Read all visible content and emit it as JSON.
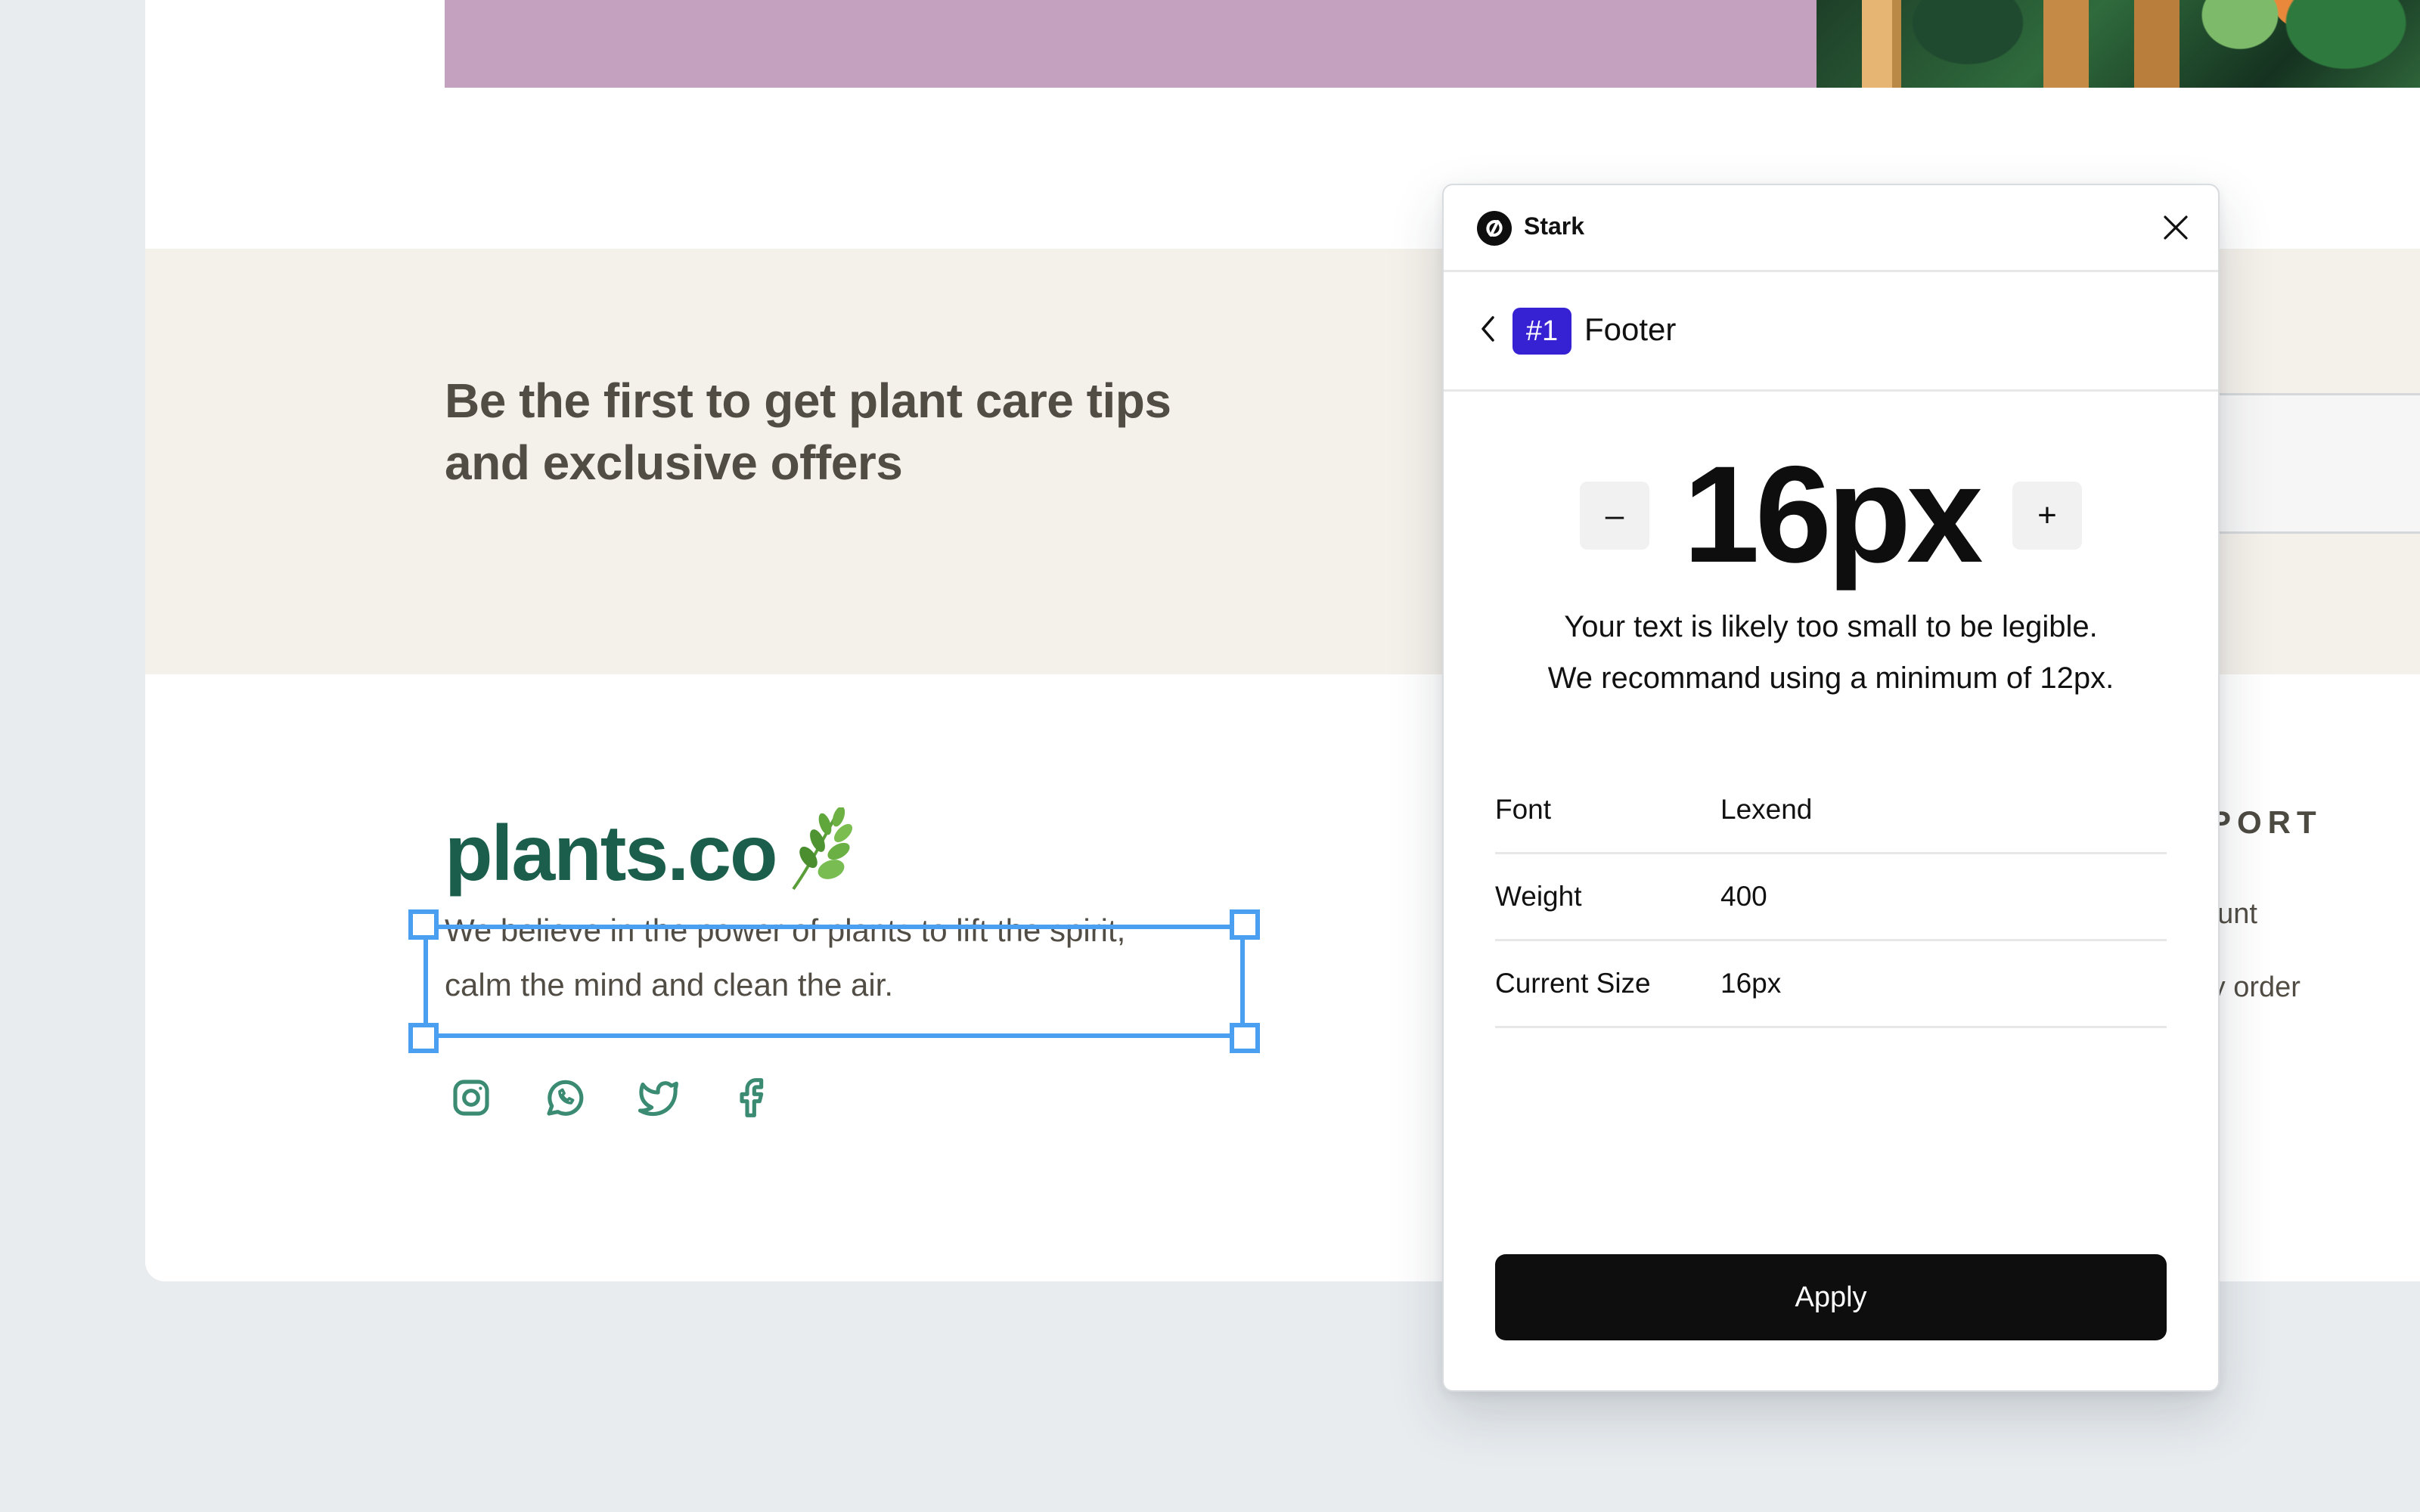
{
  "website": {
    "newsletter": {
      "title_line1": "Be the first to get plant care tips",
      "title_line2": "and exclusive offers"
    },
    "footer": {
      "logo_text": "plants.co",
      "description_line1": "We believe in the power of plants to lift the spirit,",
      "description_line2": "calm the mind and clean the air.",
      "social_icons": [
        "instagram-icon",
        "whatsapp-icon",
        "twitter-icon",
        "facebook-icon"
      ],
      "support_heading_partial": "PORT",
      "support_links_partial": [
        "count",
        "my order"
      ]
    },
    "colors": {
      "brand_green": "#1B5E4B",
      "icon_green": "#3B8A72",
      "hero_pink": "#C5A1C0",
      "band_beige": "#F4F0EA",
      "selection_blue": "#4A9FF0"
    }
  },
  "stark_panel": {
    "app_name": "Stark",
    "issue_badge": "#1",
    "section_title": "Footer",
    "size_value": "16px",
    "decrement_label": "–",
    "increment_label": "+",
    "warning_line1": "Your text is likely too small to be legible.",
    "warning_line2": "We recommand using a minimum of 12px.",
    "properties": [
      {
        "label": "Font",
        "value": "Lexend"
      },
      {
        "label": "Weight",
        "value": "400"
      },
      {
        "label": "Current Size",
        "value": "16px"
      }
    ],
    "apply_label": "Apply",
    "colors": {
      "badge": "#3722D3",
      "apply_button": "#0E0E0E"
    }
  }
}
